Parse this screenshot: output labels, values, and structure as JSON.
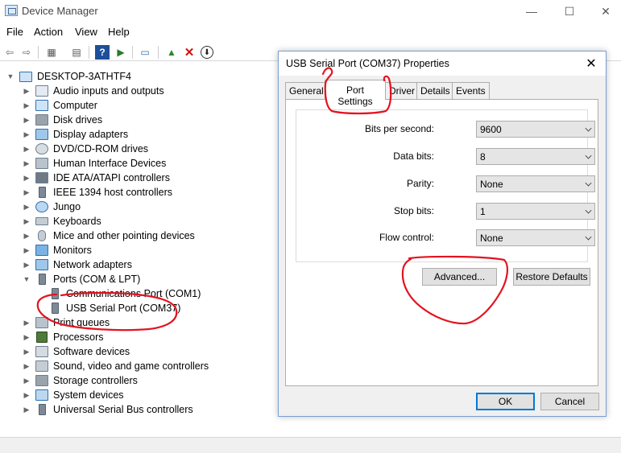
{
  "window": {
    "title": "Device Manager",
    "controls": [
      "—",
      "☐",
      "✕"
    ]
  },
  "menu": [
    "File",
    "Action",
    "View",
    "Help"
  ],
  "toolbar": [
    {
      "name": "back-arrow-icon",
      "glyph": "⇦"
    },
    {
      "name": "forward-arrow-icon",
      "glyph": "⇨"
    },
    {
      "name": "properties-icon",
      "glyph": "▦"
    },
    {
      "name": "show-hidden-icon",
      "glyph": "▤"
    },
    {
      "name": "help-icon",
      "glyph": "?"
    },
    {
      "name": "action-icon",
      "glyph": "▶"
    },
    {
      "name": "scan-hardware-icon",
      "glyph": "▭"
    },
    {
      "name": "update-driver-icon",
      "glyph": "▲"
    },
    {
      "name": "uninstall-icon",
      "glyph": "✕"
    },
    {
      "name": "disable-icon",
      "glyph": "⬇"
    }
  ],
  "tree": {
    "root": "DESKTOP-3ATHTF4",
    "items": [
      {
        "label": "Audio inputs and outputs",
        "icon": "speaker-icon",
        "expanded": false
      },
      {
        "label": "Computer",
        "icon": "computer-icon",
        "expanded": false
      },
      {
        "label": "Disk drives",
        "icon": "disk-drive-icon",
        "expanded": false
      },
      {
        "label": "Display adapters",
        "icon": "display-adapter-icon",
        "expanded": false
      },
      {
        "label": "DVD/CD-ROM drives",
        "icon": "dvd-drive-icon",
        "expanded": false
      },
      {
        "label": "Human Interface Devices",
        "icon": "hid-icon",
        "expanded": false
      },
      {
        "label": "IDE ATA/ATAPI controllers",
        "icon": "ide-controller-icon",
        "expanded": false
      },
      {
        "label": "IEEE 1394 host controllers",
        "icon": "ieee1394-icon",
        "expanded": false
      },
      {
        "label": "Jungo",
        "icon": "jungo-icon",
        "expanded": false
      },
      {
        "label": "Keyboards",
        "icon": "keyboard-icon",
        "expanded": false
      },
      {
        "label": "Mice and other pointing devices",
        "icon": "mouse-icon",
        "expanded": false
      },
      {
        "label": "Monitors",
        "icon": "monitor-icon",
        "expanded": false
      },
      {
        "label": "Network adapters",
        "icon": "network-adapter-icon",
        "expanded": false
      },
      {
        "label": "Ports (COM & LPT)",
        "icon": "port-icon",
        "expanded": true
      },
      {
        "label": "Communications Port (COM1)",
        "icon": "port-icon",
        "child": true
      },
      {
        "label": "USB Serial Port (COM37)",
        "icon": "port-icon",
        "child": true
      },
      {
        "label": "Print queues",
        "icon": "printer-icon",
        "expanded": false
      },
      {
        "label": "Processors",
        "icon": "processor-icon",
        "expanded": false
      },
      {
        "label": "Software devices",
        "icon": "software-device-icon",
        "expanded": false
      },
      {
        "label": "Sound, video and game controllers",
        "icon": "sound-icon",
        "expanded": false
      },
      {
        "label": "Storage controllers",
        "icon": "storage-controller-icon",
        "expanded": false
      },
      {
        "label": "System devices",
        "icon": "system-device-icon",
        "expanded": false
      },
      {
        "label": "Universal Serial Bus controllers",
        "icon": "usb-icon",
        "expanded": false
      }
    ]
  },
  "dialog": {
    "title": "USB Serial Port (COM37) Properties",
    "tabs": [
      "General",
      "Port Settings",
      "Driver",
      "Details",
      "Events"
    ],
    "active_tab": "Port Settings",
    "fields": [
      {
        "label": "Bits per second:",
        "value": "9600"
      },
      {
        "label": "Data bits:",
        "value": "8"
      },
      {
        "label": "Parity:",
        "value": "None"
      },
      {
        "label": "Stop bits:",
        "value": "1"
      },
      {
        "label": "Flow control:",
        "value": "None"
      }
    ],
    "advanced_label": "Advanced...",
    "restore_label": "Restore Defaults",
    "ok_label": "OK",
    "cancel_label": "Cancel"
  },
  "colors": {
    "accent": "#0078d7",
    "annotation": "#e3131f",
    "dialog_border": "#7a9fd4"
  }
}
